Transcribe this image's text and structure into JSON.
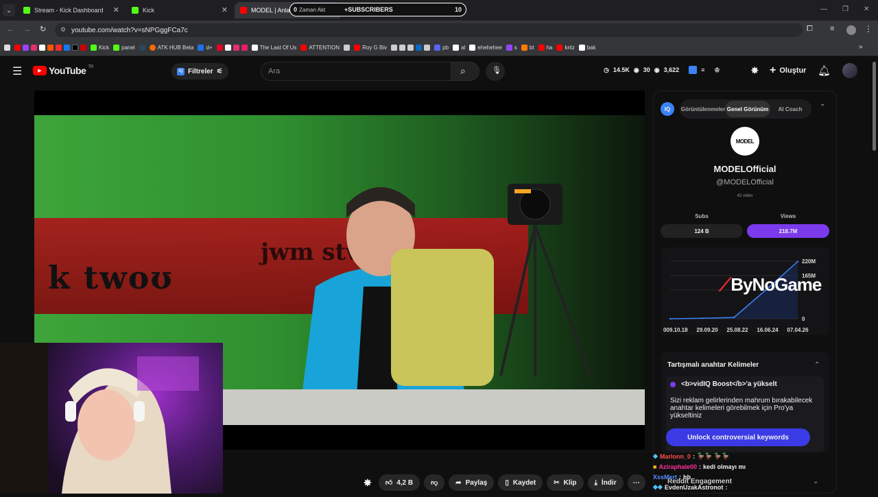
{
  "tabs": [
    {
      "title": "Stream - Kick Dashboard",
      "color": "#53fc18"
    },
    {
      "title": "Kick",
      "color": "#53fc18"
    },
    {
      "title": "MODEL | Anlam",
      "color": "#ff0000"
    }
  ],
  "overlay_pill": {
    "count_left": "0",
    "left_text": "Zaman Akt",
    "label": "SUBSCRIBERS",
    "count_right": "10"
  },
  "address": {
    "url": "youtube.com/watch?v=sNPGggFCa7c"
  },
  "bookmarks": [
    "Kick",
    "panel",
    "ATK HUB Beta",
    "d+",
    "The Last Of Us",
    "ATTENTION",
    "Roy G Biv",
    "al",
    "pb",
    "al",
    "ehehehee",
    "s",
    "bt",
    "ha",
    "knlz",
    "bak"
  ],
  "yt": {
    "logo_text": "YouTube",
    "region": "TR",
    "filters_label": "Filtreler",
    "search_placeholder": "Ara",
    "stats": {
      "views": "14.5K",
      "count2": "30",
      "count3": "3,622"
    },
    "create_label": "Oluştur"
  },
  "video": {
    "band_text": "k twoʊ",
    "band_text2": "jwm stv"
  },
  "actions": {
    "likes": "4,2 B",
    "share": "Paylaş",
    "save": "Kaydet",
    "clip": "Klip",
    "download": "İndir"
  },
  "panel": {
    "badge": "IQ",
    "tabs": [
      "Görüntülenmeler",
      "Genel Görünüm",
      "AI Coach"
    ],
    "active_tab": "Genel Görünüm",
    "channel_logo": "MODEL",
    "channel_name": "MODELOfficial",
    "channel_handle": "@MODELOfficial",
    "video_count": "42 video",
    "subs_label": "Subs",
    "subs_value": "124 B",
    "views_label": "Views",
    "views_value": "218.7M",
    "chart_y_ticks": [
      "220M",
      "165M",
      "0"
    ],
    "chart_x_ticks": [
      "0",
      "09.10.18",
      "29.09.20",
      "25.08.22",
      "16.06.24",
      "07.04.26"
    ],
    "keywords_title": "Tartışmalı anahtar Kelimeler",
    "boost_title": "<b>vidIQ Boost</b>'a yükselt",
    "boost_body": "Sizi reklam gelirlerinden mahrum bırakabilecek anahtar kelimeleri görebilmek için Pro'ya yükseltiniz",
    "unlock_label": "Unlock controversial keywords",
    "reddit_label": "Reddit Engagement"
  },
  "chart_data": {
    "type": "line",
    "x": [
      "09.10.18",
      "29.09.20",
      "25.08.22",
      "16.06.24",
      "07.04.26"
    ],
    "series": [
      {
        "values": [
          0,
          2000000,
          5000000,
          110000000,
          218700000
        ]
      }
    ],
    "ylim": [
      0,
      220000000
    ]
  },
  "chat": [
    {
      "user": "Marlonn_0",
      "msg": "",
      "color": "#ff4d4d"
    },
    {
      "user": "Aziraphale00",
      "msg": "kedi olmayı mı",
      "color": "#ff2d9a"
    },
    {
      "user": "XssMert",
      "msg": "hb",
      "color": "#5a8cff"
    },
    {
      "user": "EvdenUzakAstronot",
      "msg": "",
      "color": "#ffffff"
    }
  ],
  "watermark": "ByNoGame",
  "colors": {
    "accent": "#7c3aed",
    "unlock": "#3b3be6",
    "yt_red": "#ff0000"
  }
}
